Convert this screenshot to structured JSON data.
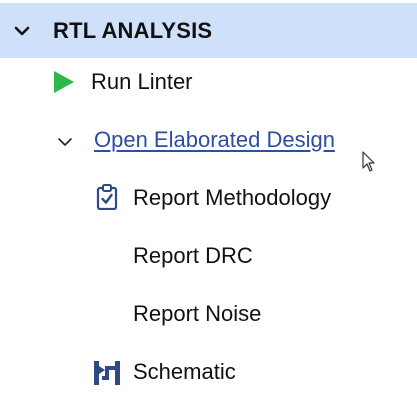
{
  "section": {
    "title": "RTL ANALYSIS",
    "expand_icon": "chevron-down-icon"
  },
  "items": [
    {
      "label": "Run Linter",
      "icon": "run-play-icon",
      "icon_color": "#2db84b"
    },
    {
      "label": "Open Elaborated Design",
      "icon": "chevron-down-icon"
    },
    {
      "label": "Report Methodology",
      "icon": "clipboard-check-icon",
      "icon_color": "#2e4a86"
    },
    {
      "label": "Report DRC"
    },
    {
      "label": "Report Noise"
    },
    {
      "label": "Schematic",
      "icon": "schematic-icon",
      "icon_color": "#2e4a86"
    }
  ],
  "colors": {
    "header_bg": "#cfe0fb",
    "link": "#2e4ea0",
    "text": "#111111"
  }
}
